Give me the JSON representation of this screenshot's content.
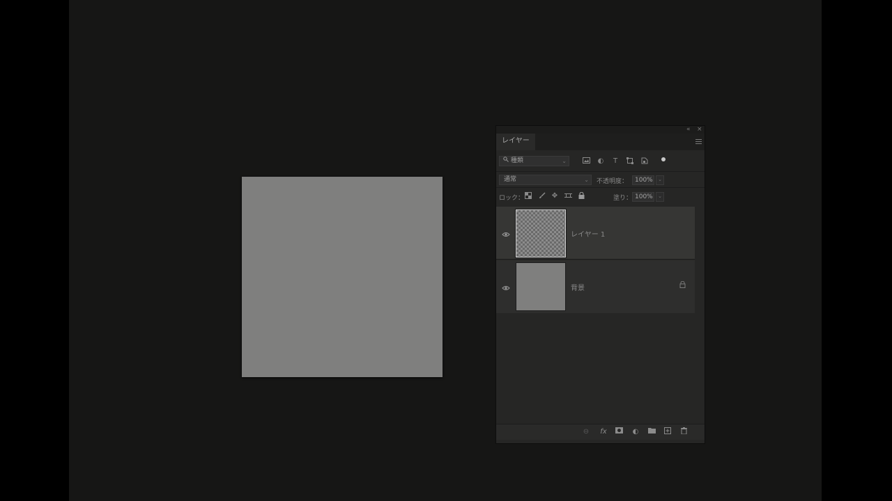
{
  "panel": {
    "controls": {
      "collapse": "«",
      "close": "×"
    },
    "tab_label": "レイヤー",
    "filter": {
      "kind_label": "種類",
      "icons": [
        "image-filter-icon",
        "adjustment-filter-icon",
        "type-filter-icon",
        "shape-filter-icon",
        "smartobject-filter-icon"
      ]
    },
    "blend_mode": "通常",
    "opacity_label": "不透明度：",
    "opacity_value": "100%",
    "lock_label": "ロック：",
    "fill_label": "塗り：",
    "fill_value": "100%",
    "layers": [
      {
        "name": "レイヤー 1",
        "visible": true,
        "selected": true,
        "locked": false
      },
      {
        "name": "背景",
        "visible": true,
        "selected": false,
        "locked": true
      }
    ]
  }
}
